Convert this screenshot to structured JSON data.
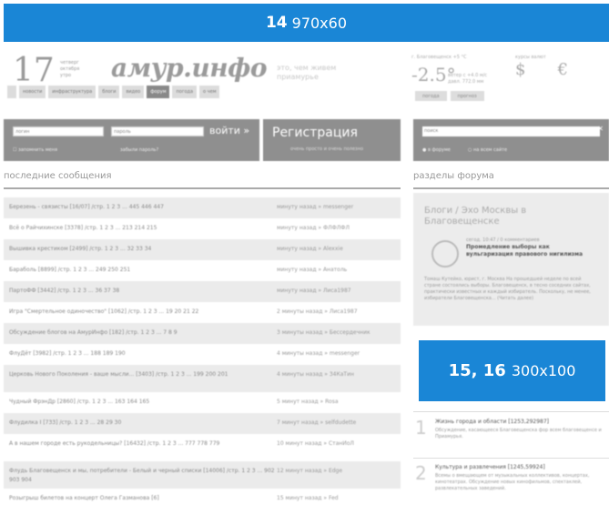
{
  "banner_top": {
    "num": "14",
    "size": "970x60"
  },
  "header": {
    "date_num": "17",
    "date_words": [
      "четверг",
      "октября",
      "утро"
    ],
    "logo": "амур.инфо",
    "slogan": "это, чем живем приамурье",
    "weather_small": "г. Благовещенск +5 °C",
    "temp": "-2.5°",
    "temp_info": [
      "ветер с +4.0 м/с",
      "давл. 772.0 мм"
    ],
    "rates_small": "курсы валют",
    "rates": [
      "$",
      "€"
    ],
    "wbuttons": [
      "погода",
      "прогноз"
    ],
    "nav": [
      "",
      "новости",
      "инфраструктура",
      "блоги",
      "видео",
      "форум",
      "погода",
      "о чем"
    ]
  },
  "login": {
    "login_placeholder": "логин",
    "pass_placeholder": "пароль",
    "button": "войти »",
    "remember": "запомнить меня",
    "forgot": "забыли пароль?"
  },
  "register": {
    "title": "Регистрация",
    "sub": "очень просто и очень полезно"
  },
  "search": {
    "placeholder": "поиск",
    "opt1": "в форуме",
    "opt2": "на всем сайте"
  },
  "latest_title": "последние сообщения",
  "forum_sections_title": "разделы форума",
  "messages": [
    {
      "title": "Березень - связисты [16/07] /стр. 1 2 3 ... 445 446 447",
      "meta": "минуту назад » messenger"
    },
    {
      "title": "Всё о Райчихинске [3378] /стр. 1 2 3 ... 213 214 215",
      "meta": "минуту назад » ФЛФЛФЛ"
    },
    {
      "title": "Вышивка крестиком [2499] /стр. 1 2 3 ... 32 33 34",
      "meta": "минуту назад » Alexxie"
    },
    {
      "title": "Бараболь [8899] /стр. 1 2 3 ... 249 250 251",
      "meta": "минуту назад » Aнатоль"
    },
    {
      "title": "ПартоФФ [3442] /стр. 1 2 3 ... 36 37 38",
      "meta": "минуту назад » Лиса1987"
    },
    {
      "title": "Игра \"Смертельное одиночество\" [1062] /стр. 1 2 3 ... 19 20 21 22",
      "meta": "2 минуты назад » Лиса1987"
    },
    {
      "title": "Обсуждение блогов на АмурИнфо [182] /стр. 1 2 3 ... 7 8 9",
      "meta": "3 минуты назад » Бессердечник"
    },
    {
      "title": "ФлуДёт [3982] /стр. 1 2 3 ... 188 189 190",
      "meta": "4 минуты назад » messenger"
    },
    {
      "title": "Церковь Нового Поколения - ваше мысли... [3403] /стр. 1 2 3 ... 199 200 201",
      "meta": "4 минуты назад » 34КаТин"
    },
    {
      "title": "Чудный ФрэнДр [2860] /стр. 1 2 3 ... 163 164 165",
      "meta": "5 минут назад » Rosa"
    },
    {
      "title": "Флудилка I [733] /стр. 1 2 3 ... 28 29 30",
      "meta": "7 минут назад » selfdudette"
    },
    {
      "title": "А в нашем городе есть рукодельницы? [16432] /стр. 1 2 3 ... 777 778 779",
      "meta": "10 минут назад » СтанИоЛ"
    },
    {
      "title": "Флудь Благовещенск и мы, потребители - Белый и черный списки [14006] /стр. 1 2 3 ... 902 903 904",
      "meta": "12 минут назад » Edge"
    },
    {
      "title": "Розыгрыш билетов на концерт Олега Газманова [6]",
      "meta": "15 минут назад » Fed"
    }
  ],
  "forum_box": {
    "heading": "Блоги / Эхо Москвы в Благовещенске",
    "art_date": "сегод. 10:47 / 0 комментариев",
    "art_title": "Промедление выборы как вульгаризация правового нигилизма",
    "art_body": "Томаш Кутейко, юрист, г. Москва На прошедшей неделе по всей стране состоялись выборы. Благовещенск, в тесно соседних сайтах, практически известных и каждый избиратель. Поскольку, не менее, избиратели Благовещенска... (Читать далее)"
  },
  "banner_side": {
    "num": "15, 16",
    "size": "300x100"
  },
  "top_topics": [
    {
      "num": "1",
      "title": "Жизнь города и области [1253,292987]",
      "desc": "Обсуждение, касающееся Благовещенска фор всем благовещенсе и Приамурья."
    },
    {
      "num": "2",
      "title": "Культура и развлечения [1245,59924]",
      "desc": "Всемы о вмещающем от музыкальных коллективов, концертах, кинотеатрах. Обсуждение новых кинофильмов, спектаклей, развлекательных заведений."
    }
  ]
}
